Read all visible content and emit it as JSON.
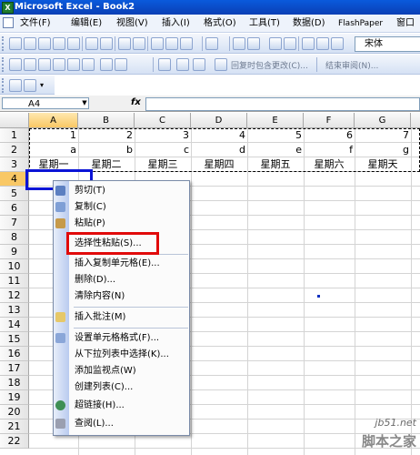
{
  "title": "Microsoft Excel - Book2",
  "menu": [
    "文件(F)",
    "编辑(E)",
    "视图(V)",
    "插入(I)",
    "格式(O)",
    "工具(T)",
    "数据(D)",
    "FlashPaper",
    "窗口"
  ],
  "toolbar": {
    "font": "宋体",
    "reply_label": "回复时包含更改(C)...",
    "end_review_label": "结束审阅(N)..."
  },
  "formula_bar": {
    "name_box": "A4",
    "fx_label": "fx",
    "value": ""
  },
  "columns": [
    "A",
    "B",
    "C",
    "D",
    "E",
    "F",
    "G"
  ],
  "rows": [
    "1",
    "2",
    "3",
    "4",
    "5",
    "6",
    "7",
    "8",
    "9",
    "10",
    "11",
    "12",
    "13",
    "14",
    "15",
    "16",
    "17",
    "18",
    "19",
    "20",
    "21",
    "22"
  ],
  "row1": [
    "1",
    "2",
    "3",
    "4",
    "5",
    "6",
    "7"
  ],
  "row2": [
    "a",
    "b",
    "c",
    "d",
    "e",
    "f",
    "g"
  ],
  "row3": [
    "星期一",
    "星期二",
    "星期三",
    "星期四",
    "星期五",
    "星期六",
    "星期天"
  ],
  "context_menu": {
    "cut": "剪切(T)",
    "copy": "复制(C)",
    "paste": "粘贴(P)",
    "paste_special": "选择性粘贴(S)...",
    "insert_copied": "插入复制单元格(E)...",
    "delete": "删除(D)...",
    "clear": "清除内容(N)",
    "insert_comment": "插入批注(M)",
    "format_cells": "设置单元格格式(F)...",
    "pick_list": "从下拉列表中选择(K)...",
    "add_watch": "添加监视点(W)",
    "create_list": "创建列表(C)...",
    "hyperlink": "超链接(H)...",
    "lookup": "查阅(L)..."
  },
  "watermark": {
    "site": "jb51.net",
    "name": "脚本之家"
  },
  "colors": {
    "title_bar": "#0a4fd0",
    "highlight_blue": "#0b14d6",
    "highlight_red": "#e10a0a"
  }
}
